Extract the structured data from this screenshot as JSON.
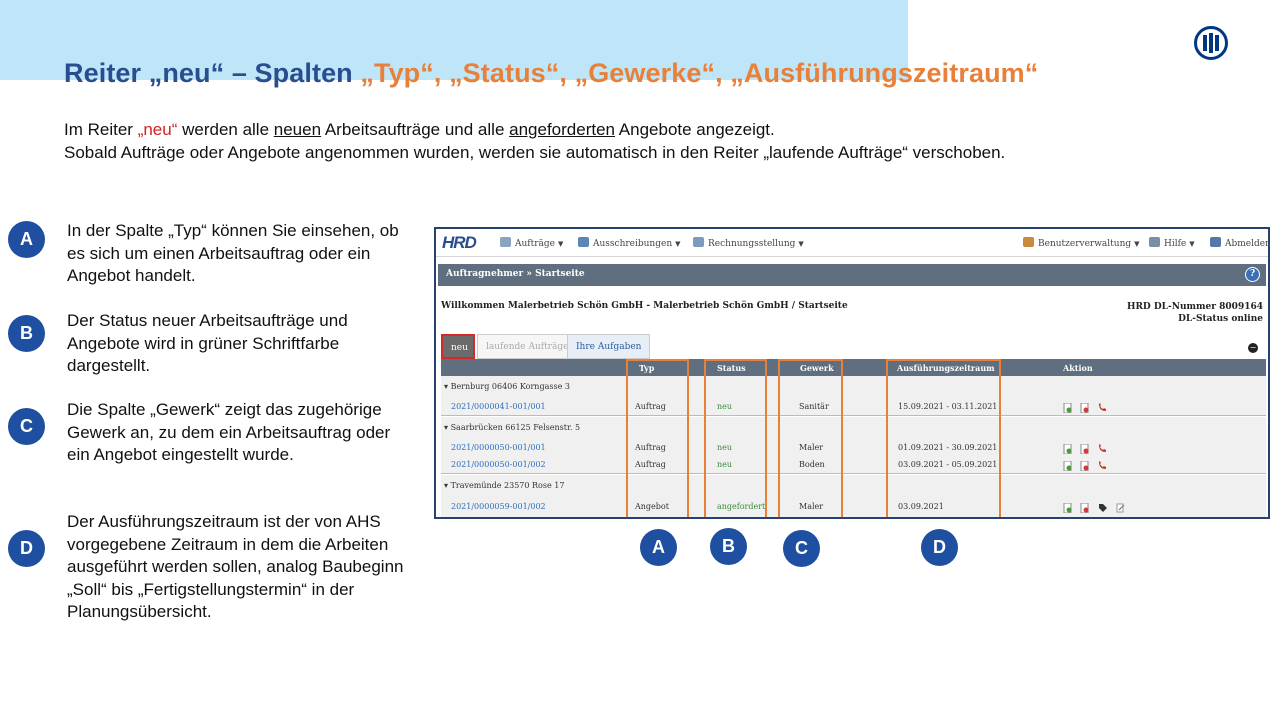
{
  "slide": {
    "title": {
      "part1": "Reiter „neu“ – Spalten ",
      "part2": "„Typ“, „Status“, „Gewerke“, „Ausführungszeitraum“"
    },
    "intro": {
      "l1a": "Im Reiter ",
      "l1_red": "„neu“",
      "l1b": " werden alle ",
      "l1_u1": "neuen",
      "l1c": " Arbeitsaufträge und alle ",
      "l1_u2": "angeforderten",
      "l1d": " Angebote angezeigt.",
      "l2": "Sobald Aufträge oder Angebote angenommen wurden, werden sie automatisch in den Reiter „laufende Aufträge“ verschoben."
    },
    "notes": [
      {
        "badge": "A",
        "text": "In der Spalte „Typ“ können Sie einsehen, ob es sich um einen Arbeitsauftrag oder ein Angebot handelt."
      },
      {
        "badge": "B",
        "text": "Der Status neuer Arbeitsaufträge und Angebote wird in grüner Schriftfarbe dargestellt."
      },
      {
        "badge": "C",
        "text": "Die Spalte „Gewerk“ zeigt das zugehörige Gewerk an, zu dem ein Arbeitsauftrag oder ein Angebot eingestellt wurde."
      },
      {
        "badge": "D",
        "text": "Der Ausführungszeitraum ist der von AHS vorgegebene Zeitraum in dem die Arbeiten ausgeführt werden sollen, analog Baubeginn „Soll“ bis „Fertigstellungstermin“ in der Planungsübersicht."
      }
    ],
    "column_badges": [
      "A",
      "B",
      "C",
      "D"
    ],
    "colors": {
      "title_blue": "#2a4d8f",
      "title_orange": "#e8803a",
      "badge_blue": "#1e4fa0",
      "status_green": "#3c8c3c",
      "highlight_orange": "#e8803a"
    }
  },
  "app": {
    "logo": "HRD",
    "menu": [
      {
        "label": "Aufträge",
        "icon": "orders-icon"
      },
      {
        "label": "Ausschreibungen",
        "icon": "tenders-icon"
      },
      {
        "label": "Rechnungsstellung",
        "icon": "billing-icon"
      },
      {
        "label": "Benutzerverwaltung",
        "icon": "users-icon"
      },
      {
        "label": "Hilfe",
        "icon": "help-book-icon"
      },
      {
        "label": "Abmelden",
        "icon": "logout-icon"
      }
    ],
    "breadcrumb": "Auftragnehmer » Startseite",
    "help_symbol": "?",
    "welcome": "Willkommen Malerbetrieb Schön GmbH - Malerbetrieb Schön GmbH / Startseite",
    "dl_number": "HRD DL-Nummer 8009164",
    "dl_status": "DL-Status online",
    "tabs": [
      {
        "label": "neu",
        "active": true
      },
      {
        "label": "laufende Aufträge",
        "active": false
      },
      {
        "label": "Ihre Aufgaben",
        "active": false
      }
    ],
    "collapse_symbol": "−",
    "columns": [
      "Typ",
      "Status",
      "Gewerk",
      "Ausführungszeitraum",
      "Aktion"
    ],
    "groups": [
      {
        "label": "Bernburg 06406 Korngasse 3",
        "rows": [
          {
            "id": "2021/0000041-001/001",
            "typ": "Auftrag",
            "status": "neu",
            "gewerk": "Sanitär",
            "zeitraum": "15.09.2021 - 03.11.2021"
          }
        ]
      },
      {
        "label": "Saarbrücken 66125 Felsenstr. 5",
        "rows": [
          {
            "id": "2021/0000050-001/001",
            "typ": "Auftrag",
            "status": "neu",
            "gewerk": "Maler",
            "zeitraum": "01.09.2021 - 30.09.2021"
          },
          {
            "id": "2021/0000050-001/002",
            "typ": "Auftrag",
            "status": "neu",
            "gewerk": "Boden",
            "zeitraum": "03.09.2021 - 05.09.2021"
          }
        ]
      },
      {
        "label": "Travemünde 23570 Rose 17",
        "rows": [
          {
            "id": "2021/0000059-001/002",
            "typ": "Angebot",
            "status": "angefordert",
            "gewerk": "Maler",
            "zeitraum": "03.09.2021"
          }
        ]
      }
    ]
  }
}
